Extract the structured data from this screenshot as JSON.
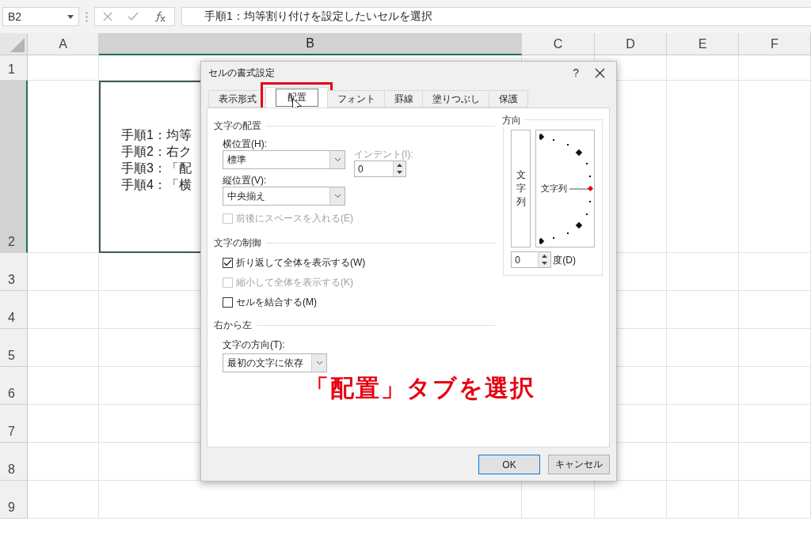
{
  "formula_bar": {
    "name_box": "B2",
    "formula": "手順1：均等割り付けを設定したいセルを選択"
  },
  "columns": [
    {
      "label": "A",
      "selected": false
    },
    {
      "label": "B",
      "selected": true
    },
    {
      "label": "C",
      "selected": false
    },
    {
      "label": "D",
      "selected": false
    },
    {
      "label": "E",
      "selected": false
    },
    {
      "label": "F",
      "selected": false
    }
  ],
  "rows": [
    {
      "label": "1",
      "selected": false
    },
    {
      "label": "2",
      "selected": true
    },
    {
      "label": "3",
      "selected": false
    },
    {
      "label": "4",
      "selected": false
    },
    {
      "label": "5",
      "selected": false
    },
    {
      "label": "6",
      "selected": false
    },
    {
      "label": "7",
      "selected": false
    },
    {
      "label": "8",
      "selected": false
    },
    {
      "label": "9",
      "selected": false
    }
  ],
  "cell_b2_lines": [
    "手順1：均等",
    "手順2：右ク",
    "手順3：「配",
    "手順4：「横"
  ],
  "dialog": {
    "title": "セルの書式設定",
    "help": "?",
    "tabs": [
      {
        "label": "表示形式",
        "selected": false
      },
      {
        "label": "配置",
        "selected": true
      },
      {
        "label": "フォント",
        "selected": false
      },
      {
        "label": "罫線",
        "selected": false
      },
      {
        "label": "塗りつぶし",
        "selected": false
      },
      {
        "label": "保護",
        "selected": false
      }
    ],
    "alignment": {
      "title": "文字の配置",
      "horizontal_label": "横位置(H):",
      "horizontal_value": "標準",
      "indent_label": "インデント(I):",
      "indent_value": "0",
      "vertical_label": "縦位置(V):",
      "vertical_value": "中央揃え",
      "justify_distributed": {
        "label": "前後にスペースを入れる(E)",
        "checked": false,
        "disabled": true
      }
    },
    "control": {
      "title": "文字の制御",
      "options": [
        {
          "label": "折り返して全体を表示する(W)",
          "checked": true,
          "disabled": false
        },
        {
          "label": "縮小して全体を表示する(K)",
          "checked": false,
          "disabled": true
        },
        {
          "label": "セルを結合する(M)",
          "checked": false,
          "disabled": false
        }
      ]
    },
    "rtl": {
      "title": "右から左",
      "direction_label": "文字の方向(T):",
      "direction_value": "最初の文字に依存"
    },
    "orientation": {
      "title": "方向",
      "vertical_text": "文字列",
      "horizontal_text": "文字列",
      "degrees": "0",
      "degrees_label": "度(D)"
    },
    "buttons": [
      {
        "label": "OK",
        "selected": true
      },
      {
        "label": "キャンセル",
        "selected": false
      }
    ]
  },
  "annotation": "「配置」タブを選択"
}
